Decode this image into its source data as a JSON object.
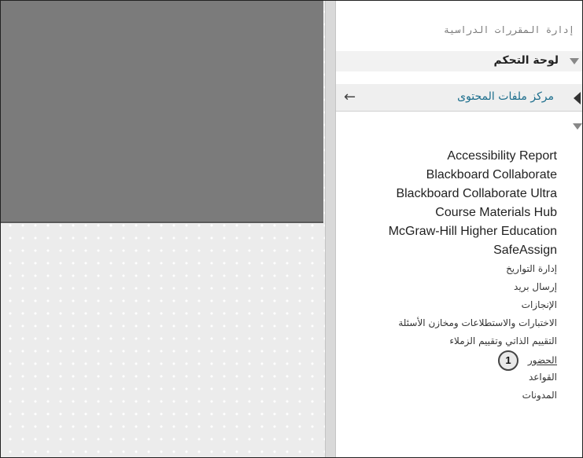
{
  "sidebar": {
    "course_management_title": "إدارة المقررات الدراسية",
    "control_panel_label": "لوحة التحكم",
    "content_collection_label": "مركز ملفات المحتوى",
    "back_arrow": "←",
    "tools": [
      {
        "label": "Accessibility Report"
      },
      {
        "label": "Blackboard Collaborate"
      },
      {
        "label": "Blackboard Collaborate Ultra"
      },
      {
        "label": "Course Materials Hub"
      },
      {
        "label": "McGraw-Hill Higher Education"
      },
      {
        "label": "SafeAssign"
      },
      {
        "label": "إدارة التواريخ"
      },
      {
        "label": "إرسال بريد"
      },
      {
        "label": "الإنجازات"
      },
      {
        "label": "الاختبارات والاستطلاعات ومخازن الأسئلة"
      },
      {
        "label": "التقييم الذاتي وتقييم الزملاء"
      },
      {
        "label": "الحضور"
      },
      {
        "label": "القواعد"
      },
      {
        "label": "المدونات"
      }
    ],
    "step_badge": "1"
  },
  "colors": {
    "link": "#1b6d8c",
    "left_block": "#7b7b7b",
    "panel_bg": "#f2f2f2"
  }
}
